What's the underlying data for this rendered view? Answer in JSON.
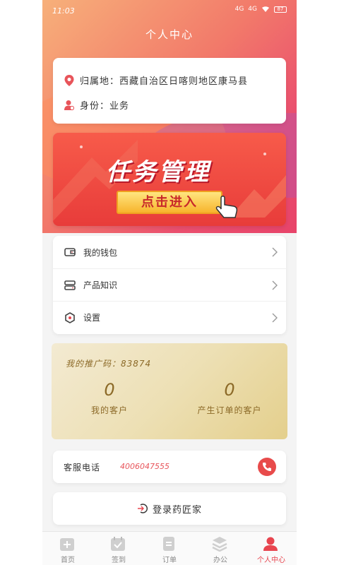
{
  "status": {
    "time": "11:03",
    "net1": "4G",
    "net2": "4G",
    "battery": "87"
  },
  "header": {
    "title": "个人中心"
  },
  "profile": {
    "location": "归属地：西藏自治区日喀则地区康马县",
    "role": "身份：业务"
  },
  "banner": {
    "title": "任务管理",
    "button": "点击进入"
  },
  "menu": {
    "items": [
      {
        "label": "我的钱包",
        "icon": "wallet-icon"
      },
      {
        "label": "产品知识",
        "icon": "book-icon"
      },
      {
        "label": "设置",
        "icon": "gear-icon"
      }
    ]
  },
  "promo": {
    "code": "我的推广码：83874",
    "stats": [
      {
        "value": "0",
        "label": "我的客户"
      },
      {
        "value": "0",
        "label": "产生订单的客户"
      }
    ]
  },
  "service": {
    "label": "客服电话",
    "phone": "4006047555"
  },
  "logout": {
    "label": "登录药匠家"
  },
  "tabs": [
    {
      "label": "首页",
      "icon": "home-plus-icon"
    },
    {
      "label": "签到",
      "icon": "calendar-check-icon"
    },
    {
      "label": "订单",
      "icon": "order-icon"
    },
    {
      "label": "办公",
      "icon": "layers-icon"
    },
    {
      "label": "个人中心",
      "icon": "person-icon"
    }
  ],
  "colors": {
    "accent": "#e8454f",
    "gold_text": "#8c6a28",
    "banner_red": "#e83c3a"
  }
}
